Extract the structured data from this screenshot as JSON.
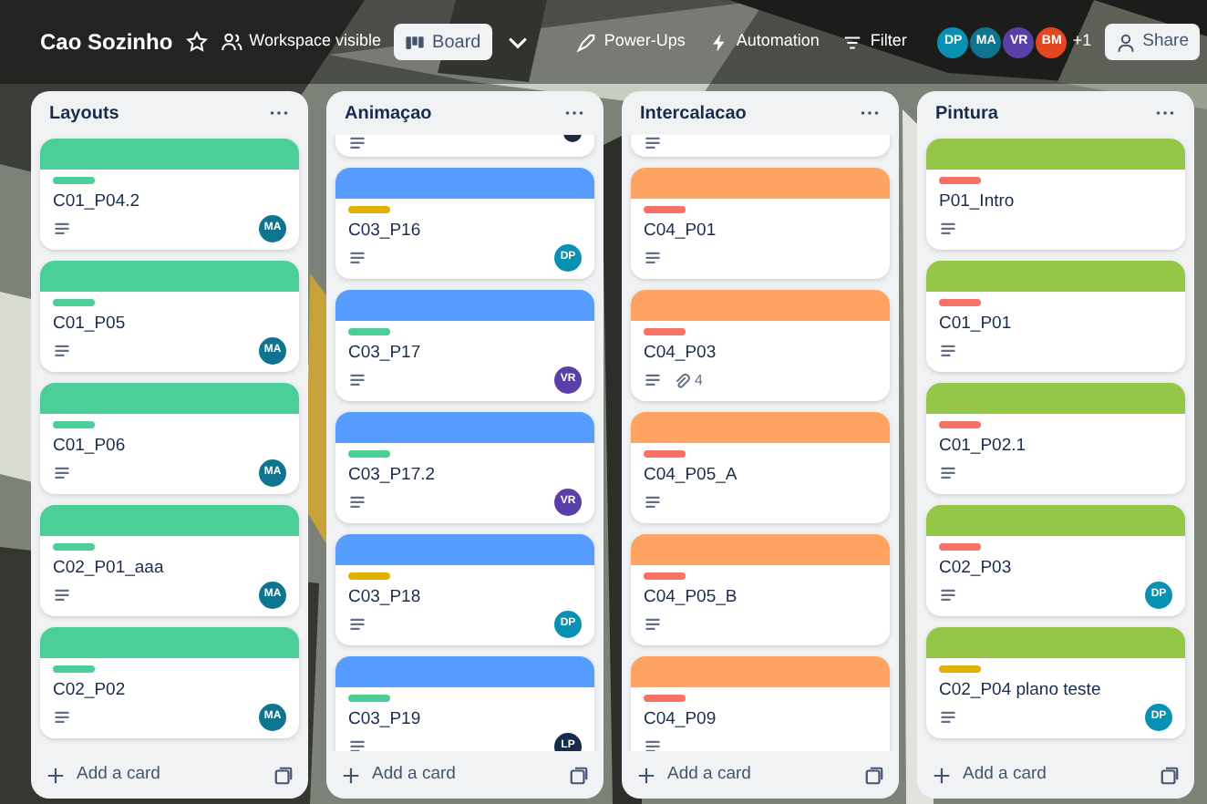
{
  "board": {
    "title": "Cao Sozinho",
    "visibility": "Workspace visible",
    "view": {
      "label": "Board",
      "selected": true
    },
    "actions": [
      "Power-Ups",
      "Automation",
      "Filter"
    ],
    "members": [
      {
        "initials": "DP",
        "color": "#0891b2"
      },
      {
        "initials": "MA",
        "color": "#0e7490"
      },
      {
        "initials": "VR",
        "color": "#5b3fa8"
      },
      {
        "initials": "BM",
        "color": "#e4471f"
      }
    ],
    "more_members": "+1",
    "share": "Share"
  },
  "lists": [
    {
      "title": "Layouts",
      "add_card": "Add a card",
      "cards": [
        {
          "kind": "card",
          "cover": {
            "color": "#4bce97"
          },
          "label": {
            "color": "#4bce97"
          },
          "title": "C01_P04.2",
          "member": {
            "initials": "MA",
            "color": "#0e7490"
          }
        },
        {
          "kind": "card",
          "cover": {
            "color": "#4bce97"
          },
          "label": {
            "color": "#4bce97"
          },
          "title": "C01_P05",
          "member": {
            "initials": "MA",
            "color": "#0e7490"
          }
        },
        {
          "kind": "card",
          "cover": {
            "color": "#4bce97"
          },
          "label": {
            "color": "#4bce97"
          },
          "title": "C01_P06",
          "member": {
            "initials": "MA",
            "color": "#0e7490"
          }
        },
        {
          "kind": "card",
          "cover": {
            "color": "#4bce97"
          },
          "label": {
            "color": "#4bce97"
          },
          "title": "C02_P01_aaa",
          "member": {
            "initials": "MA",
            "color": "#0e7490"
          }
        },
        {
          "kind": "card",
          "cover": {
            "color": "#4bce97"
          },
          "label": {
            "color": "#4bce97"
          },
          "title": "C02_P02",
          "member": {
            "initials": "MA",
            "color": "#0e7490"
          }
        }
      ]
    },
    {
      "title": "Animaçao",
      "add_card": "Add a card",
      "cards": [
        {
          "kind": "stub",
          "member": {
            "color": "#1e293b"
          }
        },
        {
          "kind": "card",
          "cover": {
            "color": "#579dff"
          },
          "label": {
            "color": "#e2b203"
          },
          "title": "C03_P16",
          "member": {
            "initials": "DP",
            "color": "#0891b2"
          }
        },
        {
          "kind": "card",
          "cover": {
            "color": "#579dff"
          },
          "label": {
            "color": "#4bce97"
          },
          "title": "C03_P17",
          "member": {
            "initials": "VR",
            "color": "#5b3fa8"
          }
        },
        {
          "kind": "card",
          "cover": {
            "color": "#579dff"
          },
          "label": {
            "color": "#4bce97"
          },
          "title": "C03_P17.2",
          "member": {
            "initials": "VR",
            "color": "#5b3fa8"
          }
        },
        {
          "kind": "card",
          "cover": {
            "color": "#579dff"
          },
          "label": {
            "color": "#e2b203"
          },
          "title": "C03_P18",
          "member": {
            "initials": "DP",
            "color": "#0891b2"
          }
        },
        {
          "kind": "card",
          "cover": {
            "color": "#579dff"
          },
          "label": {
            "color": "#4bce97"
          },
          "title": "C03_P19",
          "member": {
            "initials": "LP",
            "color": "#172b4d"
          }
        }
      ]
    },
    {
      "title": "Intercalacao",
      "add_card": "Add a card",
      "cards": [
        {
          "kind": "stub"
        },
        {
          "kind": "card",
          "cover": {
            "color": "#fea362"
          },
          "label": {
            "color": "#f87168"
          },
          "title": "C04_P01"
        },
        {
          "kind": "card",
          "cover": {
            "color": "#fea362"
          },
          "label": {
            "color": "#f87168"
          },
          "title": "C04_P03",
          "attachments": "4"
        },
        {
          "kind": "card",
          "cover": {
            "color": "#fea362"
          },
          "label": {
            "color": "#f87168"
          },
          "title": "C04_P05_A"
        },
        {
          "kind": "card",
          "cover": {
            "color": "#fea362"
          },
          "label": {
            "color": "#f87168"
          },
          "title": "C04_P05_B"
        },
        {
          "kind": "card",
          "cover": {
            "color": "#fea362"
          },
          "label": {
            "color": "#f87168"
          },
          "title": "C04_P09"
        }
      ]
    },
    {
      "title": "Pintura",
      "add_card": "Add a card",
      "cards": [
        {
          "kind": "card",
          "cover": {
            "color": "#94c748"
          },
          "label": {
            "color": "#f87168"
          },
          "title": "P01_Intro"
        },
        {
          "kind": "card",
          "cover": {
            "color": "#94c748"
          },
          "label": {
            "color": "#f87168"
          },
          "title": "C01_P01"
        },
        {
          "kind": "card",
          "cover": {
            "color": "#94c748"
          },
          "label": {
            "color": "#f87168"
          },
          "title": "C01_P02.1"
        },
        {
          "kind": "card",
          "cover": {
            "color": "#94c748"
          },
          "label": {
            "color": "#f87168"
          },
          "title": "C02_P03",
          "member": {
            "initials": "DP",
            "color": "#0891b2"
          }
        },
        {
          "kind": "card",
          "cover": {
            "color": "#94c748"
          },
          "label": {
            "color": "#e2b203"
          },
          "title": "C02_P04 plano teste",
          "member": {
            "initials": "DP",
            "color": "#0891b2"
          }
        }
      ]
    }
  ]
}
